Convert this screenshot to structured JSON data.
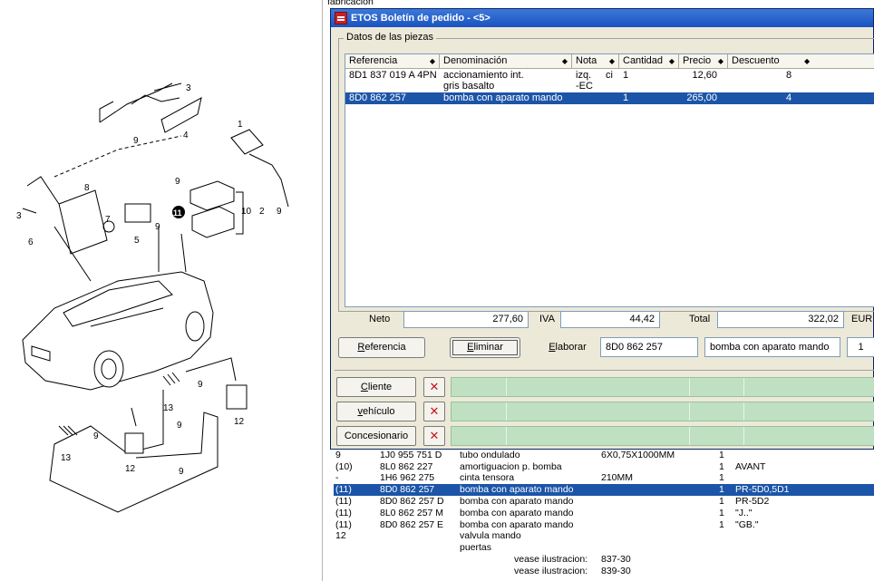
{
  "background_list": {
    "top_text": "fabricación",
    "rows": [
      {
        "pos": "9",
        "ref": "1J0 955 751 D",
        "name": "tubo ondulado",
        "info": "6X0,75X1000MM",
        "qty": "1",
        "note": "",
        "selected": false
      },
      {
        "pos": "(10)",
        "ref": "8L0 862 227",
        "name": "amortiguacion p. bomba",
        "info": "",
        "qty": "1",
        "note": "AVANT",
        "selected": false
      },
      {
        "pos": "-",
        "ref": "1H6 962 275",
        "name": "cinta tensora",
        "info": "210MM",
        "qty": "1",
        "note": "",
        "selected": false
      },
      {
        "pos": "(11)",
        "ref": "8D0 862 257",
        "name": "bomba con aparato mando",
        "info": "",
        "qty": "1",
        "note": "PR-5D0,5D1",
        "selected": true
      },
      {
        "pos": "(11)",
        "ref": "8D0 862 257 D",
        "name": "bomba con aparato mando",
        "info": "",
        "qty": "1",
        "note": "PR-5D2",
        "selected": false
      },
      {
        "pos": "(11)",
        "ref": "8L0 862 257 M",
        "name": "bomba con aparato mando",
        "info": "",
        "qty": "1",
        "note": "\"J..\"",
        "selected": false
      },
      {
        "pos": "(11)",
        "ref": "8D0 862 257 E",
        "name": "bomba con aparato mando",
        "info": "",
        "qty": "1",
        "note": "\"GB.\"",
        "selected": false
      },
      {
        "pos": "12",
        "ref": "",
        "name": "valvula mando",
        "info": "",
        "qty": "",
        "note": "",
        "selected": false
      },
      {
        "pos": "",
        "ref": "",
        "name": "puertas",
        "info": "",
        "qty": "",
        "note": "",
        "selected": false
      },
      {
        "pos": "",
        "ref": "",
        "name": "vease ilustracion:",
        "info": "837-30",
        "qty": "",
        "note": "",
        "selected": false,
        "indent": true
      },
      {
        "pos": "",
        "ref": "",
        "name": "vease ilustracion:",
        "info": "839-30",
        "qty": "",
        "note": "",
        "selected": false,
        "indent": true
      }
    ]
  },
  "dialog": {
    "title": "ETOS Boletín de pedido - <5>",
    "group_label": "Datos de las piezas",
    "columns": [
      "Referencia",
      "Denominación",
      "Nota",
      "Cantidad",
      "Precio",
      "Descuento"
    ],
    "rows": [
      {
        "ref": "8D1 837 019 A  4PN",
        "name": "accionamiento int.",
        "name2": "gris basalto",
        "note": "izq.",
        "note_b": "ci",
        "note2": "-EC",
        "qty": "1",
        "price": "12,60",
        "discount": "8",
        "selected": false
      },
      {
        "ref": "8D0 862 257",
        "name": "bomba con aparato mando",
        "name2": "",
        "note": "",
        "note_b": "",
        "note2": "",
        "qty": "1",
        "price": "265,00",
        "discount": "4",
        "selected": true
      }
    ],
    "totals": {
      "neto_label": "Neto",
      "neto": "277,60",
      "iva_label": "IVA",
      "iva": "44,42",
      "total_label": "Total",
      "total": "322,02",
      "currency": "EUR"
    },
    "actions": {
      "referencia_pre": "",
      "referencia_key": "R",
      "referencia_post": "eferencia",
      "eliminar_key": "E",
      "eliminar_post": "liminar",
      "elaborar_key": "E",
      "elaborar_post": "laborar",
      "field_ref": "8D0 862 257",
      "field_name": "bomba con aparato mando",
      "field_qty": "1"
    },
    "lower": [
      {
        "key": "C",
        "rest": "liente",
        "pre": ""
      },
      {
        "key": "v",
        "rest": "ehículo",
        "pre": ""
      },
      {
        "key": "",
        "rest": "Concesionario",
        "pre": ""
      }
    ],
    "close_glyph": "✕"
  },
  "diagram_labels": [
    "3",
    "4",
    "9",
    "1",
    "9",
    "8",
    "3",
    "6",
    "7",
    "5",
    "9",
    "11",
    "10",
    "2",
    "9",
    "9",
    "13",
    "12",
    "9",
    "13",
    "9",
    "12",
    "9"
  ]
}
